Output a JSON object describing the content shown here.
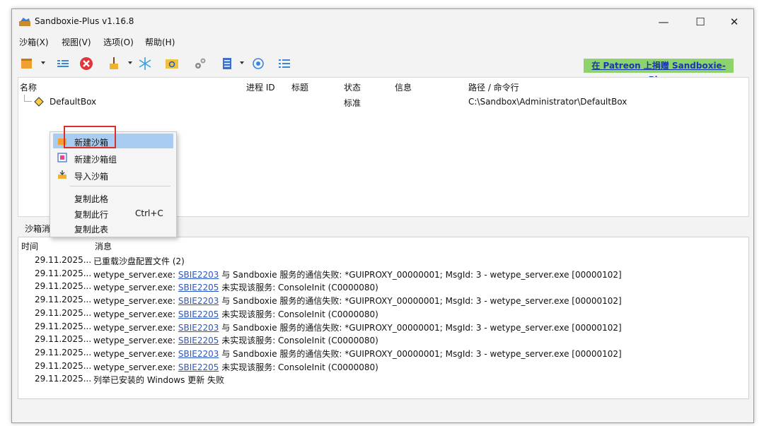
{
  "window": {
    "title": "Sandboxie-Plus v1.16.8",
    "controls": {
      "minimize": "—",
      "maximize": "☐",
      "close": "✕"
    }
  },
  "menu": [
    "沙箱(X)",
    "视图(V)",
    "选项(O)",
    "帮助(H)"
  ],
  "toolbar": {
    "icons": [
      "new-box-icon",
      "list-view-icon",
      "terminate-all-icon",
      "cleanup-icon",
      "snowflake-icon",
      "browse-icon",
      "settings-gear-icon",
      "notepad-icon",
      "target-icon",
      "list-icon"
    ],
    "patreon_link": "在 Patreon 上捐赠 Sandboxie-Plus"
  },
  "tree": {
    "columns": [
      "名称",
      "进程 ID",
      "标题",
      "状态",
      "信息",
      "路径 / 命令行"
    ],
    "rows": [
      {
        "name": "DefaultBox",
        "status": "标准",
        "path": "C:\\Sandbox\\Administrator\\DefaultBox"
      }
    ]
  },
  "context_menu": {
    "items": [
      {
        "label": "新建沙箱",
        "icon": "new-box-icon",
        "active": true
      },
      {
        "label": "新建沙箱组",
        "icon": "box-group-icon"
      },
      {
        "label": "导入沙箱",
        "icon": "import-box-icon"
      },
      {
        "label": "复制此格"
      },
      {
        "label": "复制此行",
        "shortcut": "Ctrl+C"
      },
      {
        "label": "复制此表"
      }
    ]
  },
  "log_tab": {
    "label": "沙箱消息"
  },
  "log": {
    "columns": [
      "时间",
      "消息"
    ],
    "rows": [
      {
        "time": "29.11.2025...",
        "pre": "已重载沙盘配置文件 (2)"
      },
      {
        "time": "29.11.2025...",
        "pre": "wetype_server.exe: ",
        "link": "SBIE2203",
        "post": " 与 Sandboxie 服务的通信失败: *GUIPROXY_00000001; MsgId: 3 - wetype_server.exe [00000102]"
      },
      {
        "time": "29.11.2025...",
        "pre": "wetype_server.exe: ",
        "link": "SBIE2205",
        "post": " 未实现该服务: ConsoleInit (C0000080)"
      },
      {
        "time": "29.11.2025...",
        "pre": "wetype_server.exe: ",
        "link": "SBIE2203",
        "post": " 与 Sandboxie 服务的通信失败: *GUIPROXY_00000001; MsgId: 3 - wetype_server.exe [00000102]"
      },
      {
        "time": "29.11.2025...",
        "pre": "wetype_server.exe: ",
        "link": "SBIE2205",
        "post": " 未实现该服务: ConsoleInit (C0000080)"
      },
      {
        "time": "29.11.2025...",
        "pre": "wetype_server.exe: ",
        "link": "SBIE2203",
        "post": " 与 Sandboxie 服务的通信失败: *GUIPROXY_00000001; MsgId: 3 - wetype_server.exe [00000102]"
      },
      {
        "time": "29.11.2025...",
        "pre": "wetype_server.exe: ",
        "link": "SBIE2205",
        "post": " 未实现该服务: ConsoleInit (C0000080)"
      },
      {
        "time": "29.11.2025...",
        "pre": "wetype_server.exe: ",
        "link": "SBIE2203",
        "post": " 与 Sandboxie 服务的通信失败: *GUIPROXY_00000001; MsgId: 3 - wetype_server.exe [00000102]"
      },
      {
        "time": "29.11.2025...",
        "pre": "wetype_server.exe: ",
        "link": "SBIE2205",
        "post": " 未实现该服务: ConsoleInit (C0000080)"
      },
      {
        "time": "29.11.2025...",
        "pre": "列举已安装的 Windows 更新 失败"
      }
    ]
  },
  "colors": {
    "accent": "#a9cdf2",
    "highlight_border": "#d9302c",
    "patreon_bg": "#8bd36a",
    "link": "#2a56c6"
  }
}
